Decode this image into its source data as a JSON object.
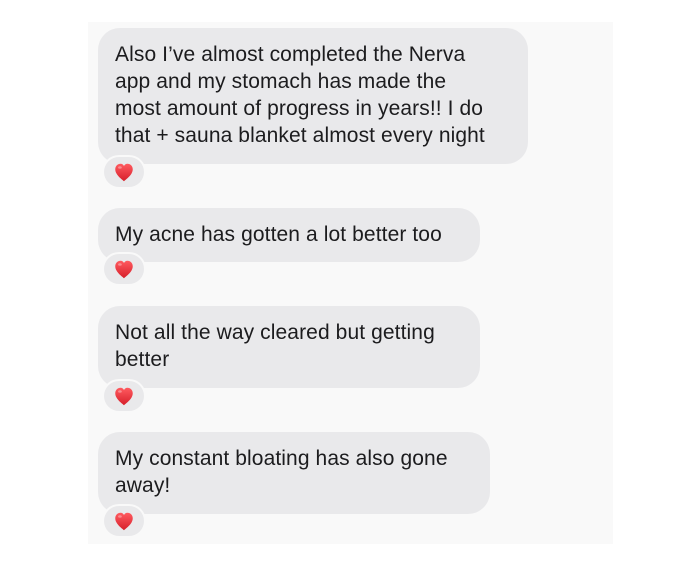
{
  "conversation": {
    "messages": [
      {
        "text": "Also I’ve almost completed the Nerva\napp and my stomach has made the\nmost amount of progress in years!! I do\nthat + sauna blanket almost every night",
        "reaction": "red-heart-icon"
      },
      {
        "text": "My acne has gotten a lot better too",
        "reaction": "red-heart-icon"
      },
      {
        "text": "Not all the way cleared but getting\nbetter",
        "reaction": "red-heart-icon"
      },
      {
        "text": "My constant bloating has also gone\naway!",
        "reaction": "red-heart-icon"
      }
    ]
  },
  "colors": {
    "bubble_background": "#e9e9eb",
    "text": "#1c1c1e",
    "heart": "#e0242e",
    "panel_background": "#f9f9f9"
  }
}
